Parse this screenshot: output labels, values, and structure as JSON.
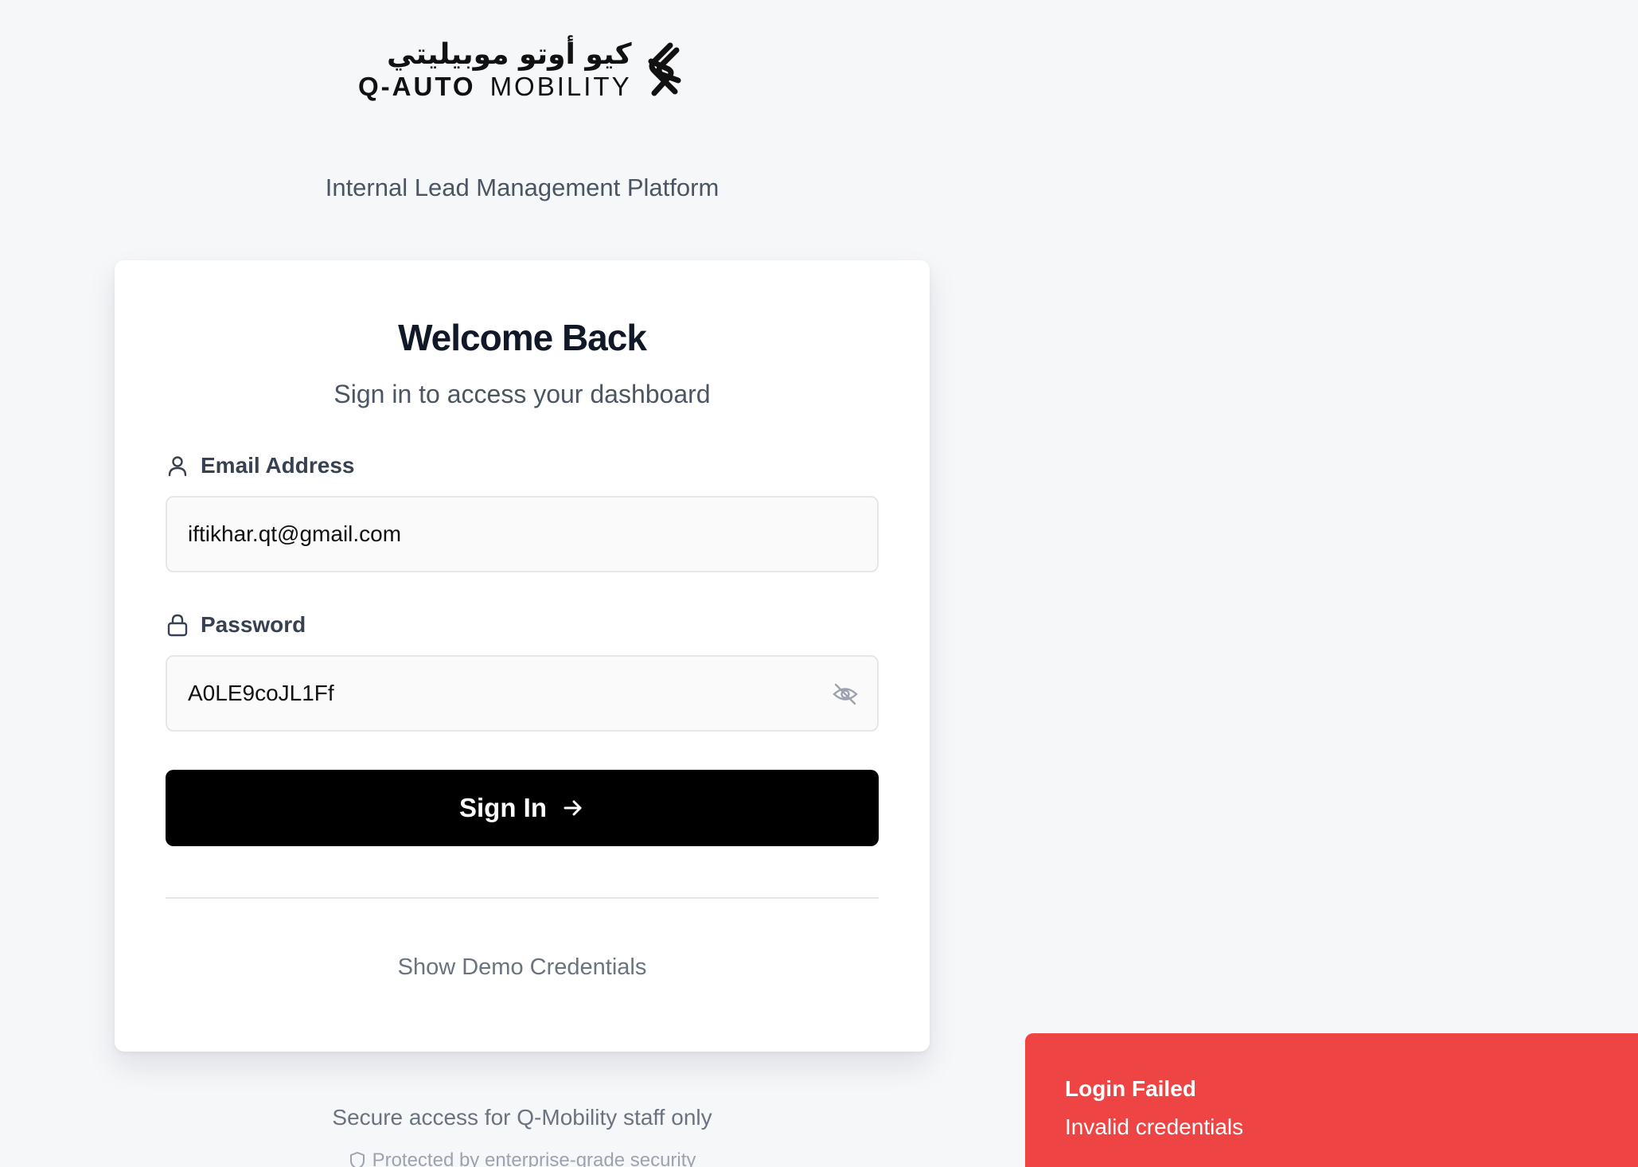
{
  "brand": {
    "logo_arabic": "كيو أوتو موبيليتي",
    "logo_latin_strong": "Q-AUTO",
    "logo_latin_light": "MOBILITY"
  },
  "tagline": "Internal Lead Management Platform",
  "card": {
    "title": "Welcome Back",
    "subtitle": "Sign in to access your dashboard"
  },
  "email": {
    "label": "Email Address",
    "value": "iftikhar.qt@gmail.com"
  },
  "password": {
    "label": "Password",
    "value": "A0LE9coJL1Ff",
    "visible": true
  },
  "signin_label": "Sign In",
  "demo_link": "Show Demo Credentials",
  "footer": {
    "note": "Secure access for Q-Mobility staff only",
    "security": "Protected by enterprise-grade security"
  },
  "toast": {
    "title": "Login Failed",
    "description": "Invalid credentials",
    "color": "#ef4444"
  }
}
